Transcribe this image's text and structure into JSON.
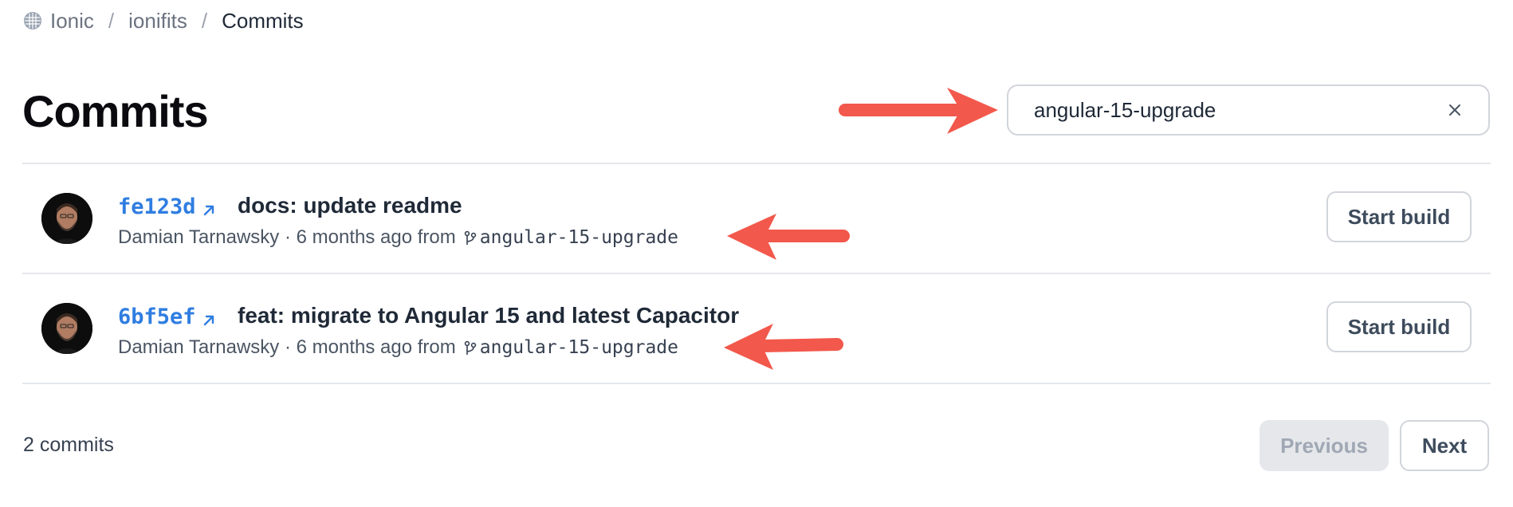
{
  "breadcrumb": {
    "org": "Ionic",
    "app": "ionifits",
    "current": "Commits",
    "separator": "/"
  },
  "page": {
    "title": "Commits"
  },
  "search": {
    "value": "angular-15-upgrade"
  },
  "commits": [
    {
      "sha": "fe123d",
      "message": "docs: update readme",
      "author": "Damian Tarnawsky",
      "time": "6 months ago",
      "from_label": "from",
      "branch": "angular-15-upgrade",
      "action_label": "Start build"
    },
    {
      "sha": "6bf5ef",
      "message": "feat: migrate to Angular 15 and latest Capacitor",
      "author": "Damian Tarnawsky",
      "time": "6 months ago",
      "from_label": "from",
      "branch": "angular-15-upgrade",
      "action_label": "Start build"
    }
  ],
  "footer": {
    "count_text": "2 commits",
    "previous_label": "Previous",
    "next_label": "Next"
  },
  "colors": {
    "link": "#2f7de1",
    "annotation_arrow": "#f2584b",
    "disabled_button": "#e5e7eb"
  },
  "icons": [
    "org-icon",
    "clear-icon",
    "external-link-icon",
    "branch-icon"
  ]
}
